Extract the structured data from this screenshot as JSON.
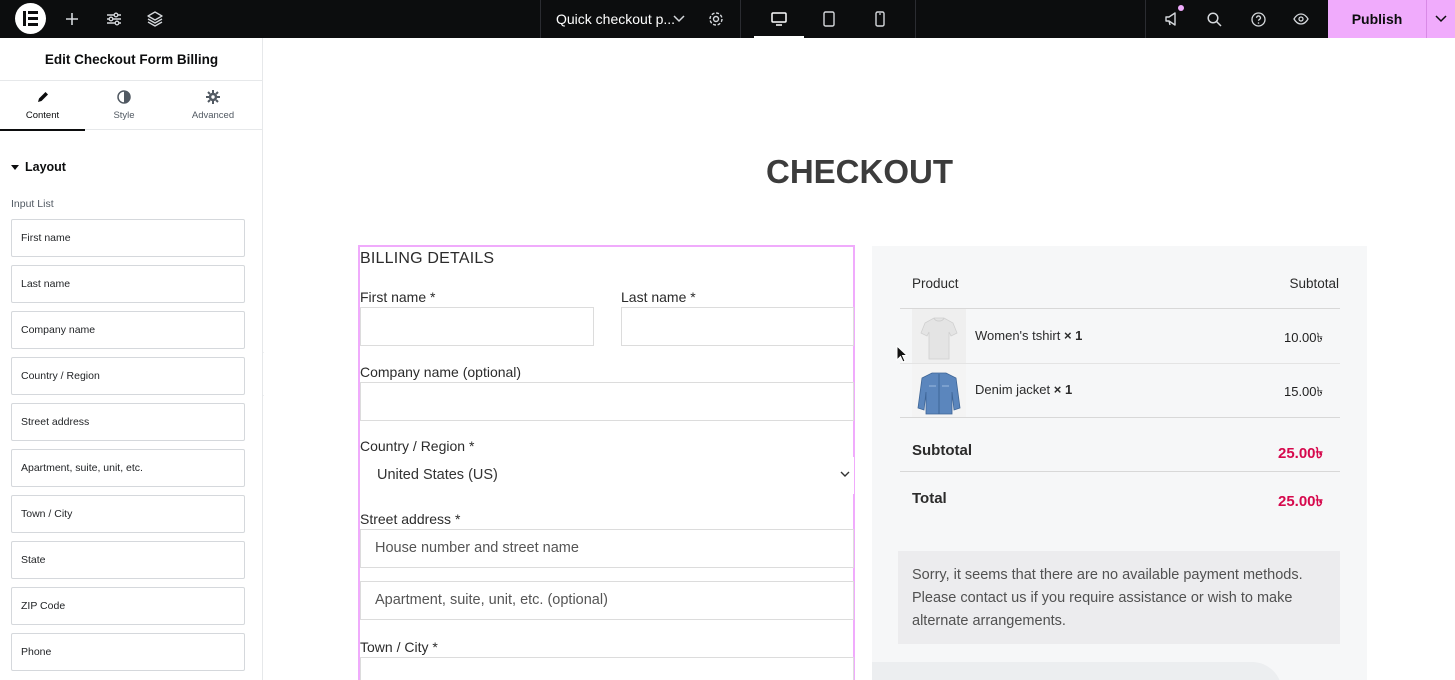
{
  "topbar": {
    "document_title": "Quick checkout p...",
    "publish_label": "Publish",
    "accent": "#f0abfc"
  },
  "panel": {
    "title": "Edit Checkout Form Billing",
    "tabs": [
      {
        "label": "Content",
        "icon": "pencil-icon"
      },
      {
        "label": "Style",
        "icon": "contrast-icon"
      },
      {
        "label": "Advanced",
        "icon": "gear-icon"
      }
    ],
    "section_title": "Layout",
    "input_list_label": "Input List",
    "input_list": [
      "First name",
      "Last name",
      "Company name",
      "Country / Region",
      "Street address",
      "Apartment, suite, unit, etc.",
      "Town / City",
      "State",
      "ZIP Code",
      "Phone"
    ]
  },
  "page": {
    "title": "CHECKOUT",
    "billing": {
      "heading": "BILLING DETAILS",
      "first_name_label": "First name *",
      "last_name_label": "Last name *",
      "company_label": "Company name (optional)",
      "country_label": "Country / Region *",
      "country_value": "United States (US)",
      "street_label": "Street address *",
      "street_placeholder": "House number and street name",
      "apartment_placeholder": "Apartment, suite, unit, etc. (optional)",
      "town_label": "Town / City *"
    },
    "order": {
      "col_product": "Product",
      "col_subtotal": "Subtotal",
      "items": [
        {
          "name": "Women's tshirt",
          "qty": "× 1",
          "price": "10.00৳"
        },
        {
          "name": "Denim jacket",
          "qty": "× 1",
          "price": "15.00৳"
        }
      ],
      "subtotal_label": "Subtotal",
      "subtotal_value": "25.00৳",
      "total_label": "Total",
      "total_value": "25.00৳",
      "notice": "Sorry, it seems that there are no available payment methods. Please contact us if you require assistance or wish to make alternate arrangements."
    }
  }
}
